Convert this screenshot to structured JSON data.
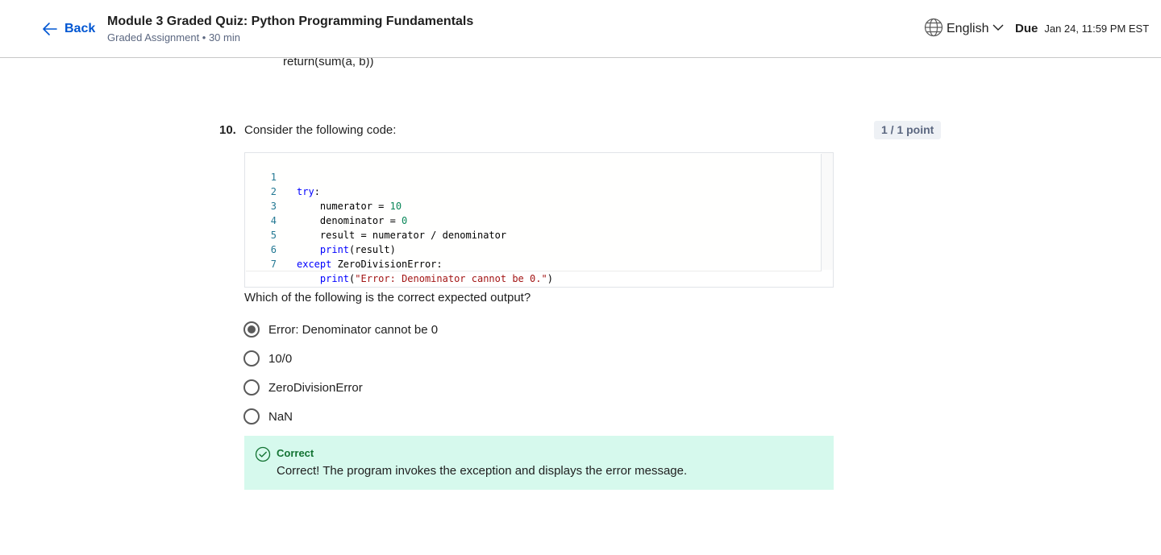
{
  "header": {
    "back_label": "Back",
    "title": "Module 3 Graded Quiz: Python Programming Fundamentals",
    "subtitle": "Graded Assignment • 30 min",
    "language": "English",
    "due_label": "Due",
    "due_date": "Jan 24, 11:59 PM EST"
  },
  "previous_code_tail": "return(sum(a, b))",
  "question": {
    "number": "10.",
    "prompt": "Consider the following code:",
    "points": "1 / 1 point",
    "code_lines": [
      {
        "n": "1"
      },
      {
        "n": "2"
      },
      {
        "n": "3"
      },
      {
        "n": "4"
      },
      {
        "n": "5"
      },
      {
        "n": "6"
      },
      {
        "n": "7"
      }
    ],
    "code_tokens": {
      "l1_kw": "try",
      "l1_rest": ":",
      "l2_a": "    numerator = ",
      "l2_num": "10",
      "l3_a": "    denominator = ",
      "l3_num": "0",
      "l4": "    result = numerator / denominator",
      "l5_indent": "    ",
      "l5_kw": "print",
      "l5_rest": "(result)",
      "l6_kw": "except",
      "l6_rest": " ZeroDivisionError:",
      "l7_indent": "    ",
      "l7_kw": "print",
      "l7_open": "(",
      "l7_str": "\"Error: Denominator cannot be 0.\"",
      "l7_close": ")"
    },
    "which_prompt": "Which of the following is the correct expected output?",
    "options": [
      {
        "label": "Error: Denominator cannot be 0",
        "selected": true
      },
      {
        "label": "10/0",
        "selected": false
      },
      {
        "label": "ZeroDivisionError",
        "selected": false
      },
      {
        "label": "NaN",
        "selected": false
      }
    ],
    "feedback": {
      "status": "Correct",
      "message": "Correct! The program invokes the exception and displays the error message.",
      "color": "#d6f9ed"
    }
  }
}
